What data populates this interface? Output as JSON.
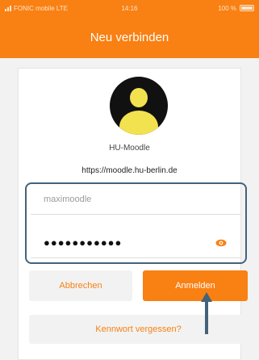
{
  "status_bar": {
    "carrier": "FONIC mobile  LTE",
    "time": "14:16",
    "battery": "100 %"
  },
  "header": {
    "title": "Neu verbinden"
  },
  "site": {
    "name": "HU-Moodle",
    "url": "https://moodle.hu-berlin.de"
  },
  "login_form": {
    "username_value": "maximoodle",
    "password_masked": "●●●●●●●●●●●"
  },
  "buttons": {
    "cancel": "Abbrechen",
    "login": "Anmelden",
    "forgot_password": "Kennwort vergessen?"
  },
  "colors": {
    "brand": "#f98012",
    "annotation": "#44627a",
    "avatar_figure": "#f3e24f"
  },
  "icons": {
    "signal": "signal-icon",
    "battery": "battery-icon",
    "avatar": "user-avatar-icon",
    "show_password": "eye-icon",
    "arrow": "up-arrow-icon"
  }
}
